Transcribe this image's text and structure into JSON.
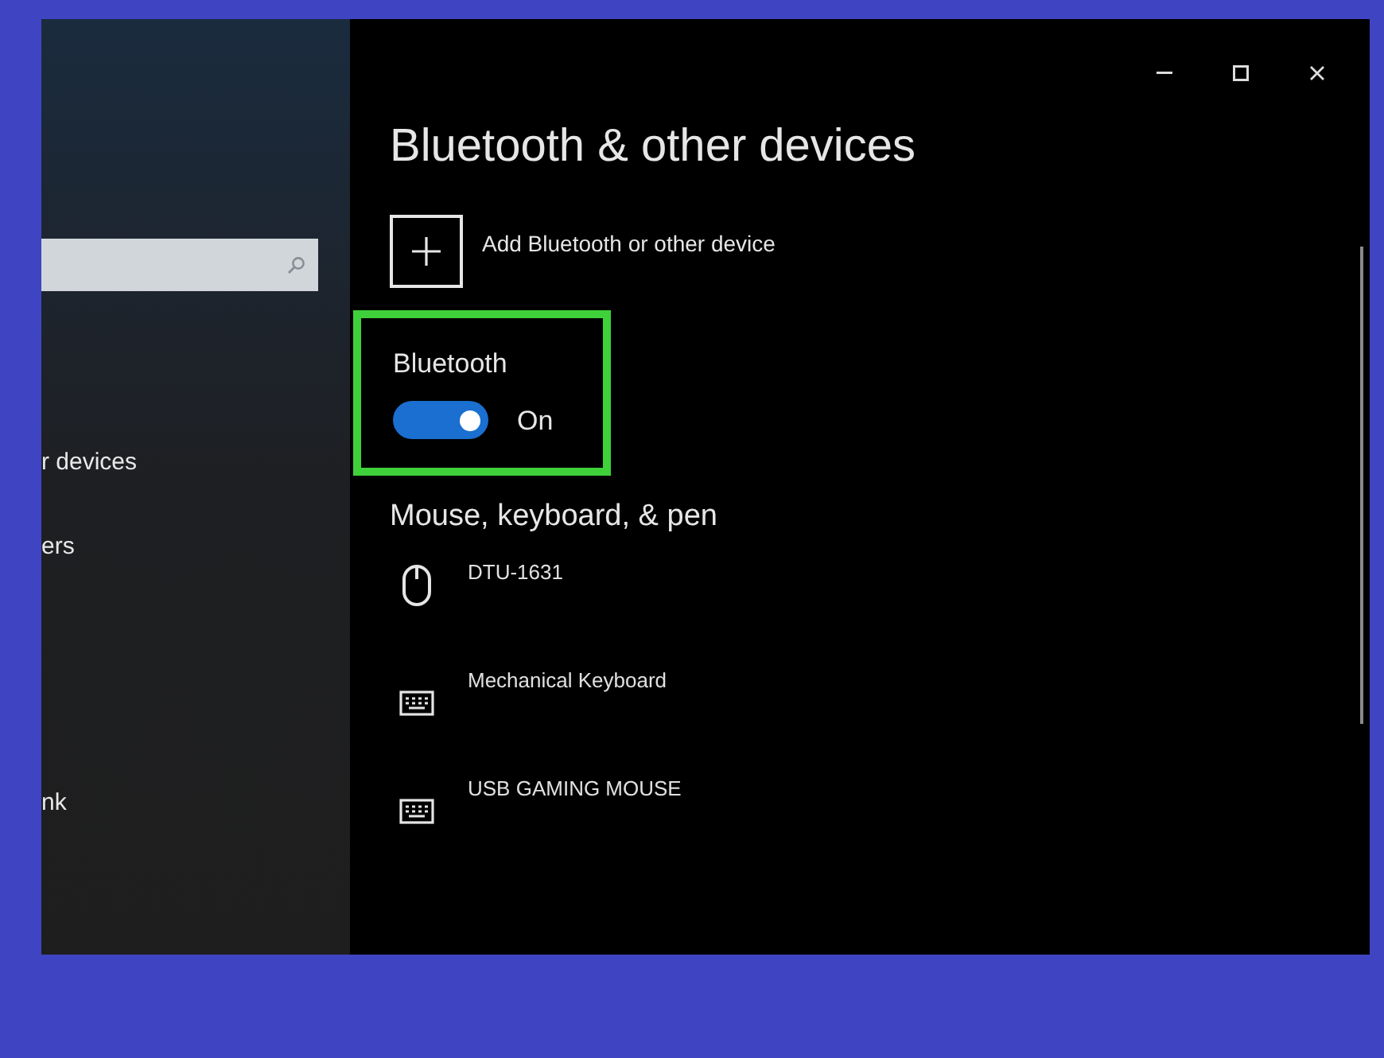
{
  "window": {
    "title": "Bluetooth & other devices"
  },
  "sidebar": {
    "items": [
      {
        "label": "r devices"
      },
      {
        "label": "ers"
      },
      {
        "label": "nk"
      }
    ]
  },
  "add_device": {
    "label": "Add Bluetooth or other device"
  },
  "bluetooth": {
    "heading": "Bluetooth",
    "on": true,
    "state_label": "On",
    "highlighted": true
  },
  "section": {
    "heading": "Mouse, keyboard, & pen"
  },
  "devices": [
    {
      "kind": "mouse",
      "name": "DTU-1631"
    },
    {
      "kind": "keyboard",
      "name": "Mechanical Keyboard"
    },
    {
      "kind": "keyboard",
      "name": "USB GAMING MOUSE"
    }
  ]
}
